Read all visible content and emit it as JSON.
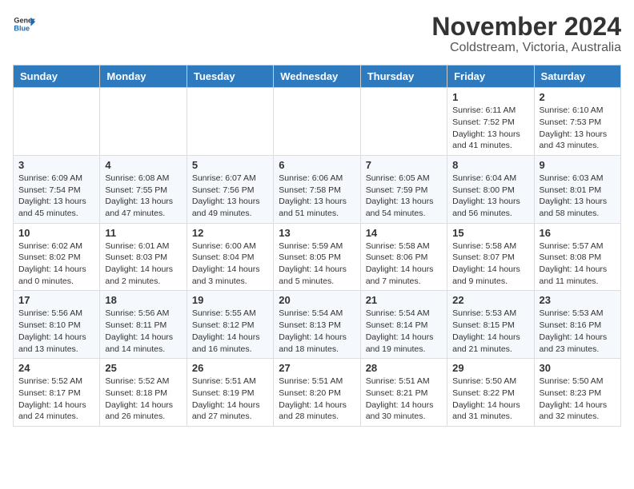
{
  "logo": {
    "general": "General",
    "blue": "Blue"
  },
  "title": "November 2024",
  "subtitle": "Coldstream, Victoria, Australia",
  "days": [
    "Sunday",
    "Monday",
    "Tuesday",
    "Wednesday",
    "Thursday",
    "Friday",
    "Saturday"
  ],
  "weeks": [
    [
      {
        "date": "",
        "info": ""
      },
      {
        "date": "",
        "info": ""
      },
      {
        "date": "",
        "info": ""
      },
      {
        "date": "",
        "info": ""
      },
      {
        "date": "",
        "info": ""
      },
      {
        "date": "1",
        "info": "Sunrise: 6:11 AM\nSunset: 7:52 PM\nDaylight: 13 hours\nand 41 minutes."
      },
      {
        "date": "2",
        "info": "Sunrise: 6:10 AM\nSunset: 7:53 PM\nDaylight: 13 hours\nand 43 minutes."
      }
    ],
    [
      {
        "date": "3",
        "info": "Sunrise: 6:09 AM\nSunset: 7:54 PM\nDaylight: 13 hours\nand 45 minutes."
      },
      {
        "date": "4",
        "info": "Sunrise: 6:08 AM\nSunset: 7:55 PM\nDaylight: 13 hours\nand 47 minutes."
      },
      {
        "date": "5",
        "info": "Sunrise: 6:07 AM\nSunset: 7:56 PM\nDaylight: 13 hours\nand 49 minutes."
      },
      {
        "date": "6",
        "info": "Sunrise: 6:06 AM\nSunset: 7:58 PM\nDaylight: 13 hours\nand 51 minutes."
      },
      {
        "date": "7",
        "info": "Sunrise: 6:05 AM\nSunset: 7:59 PM\nDaylight: 13 hours\nand 54 minutes."
      },
      {
        "date": "8",
        "info": "Sunrise: 6:04 AM\nSunset: 8:00 PM\nDaylight: 13 hours\nand 56 minutes."
      },
      {
        "date": "9",
        "info": "Sunrise: 6:03 AM\nSunset: 8:01 PM\nDaylight: 13 hours\nand 58 minutes."
      }
    ],
    [
      {
        "date": "10",
        "info": "Sunrise: 6:02 AM\nSunset: 8:02 PM\nDaylight: 14 hours\nand 0 minutes."
      },
      {
        "date": "11",
        "info": "Sunrise: 6:01 AM\nSunset: 8:03 PM\nDaylight: 14 hours\nand 2 minutes."
      },
      {
        "date": "12",
        "info": "Sunrise: 6:00 AM\nSunset: 8:04 PM\nDaylight: 14 hours\nand 3 minutes."
      },
      {
        "date": "13",
        "info": "Sunrise: 5:59 AM\nSunset: 8:05 PM\nDaylight: 14 hours\nand 5 minutes."
      },
      {
        "date": "14",
        "info": "Sunrise: 5:58 AM\nSunset: 8:06 PM\nDaylight: 14 hours\nand 7 minutes."
      },
      {
        "date": "15",
        "info": "Sunrise: 5:58 AM\nSunset: 8:07 PM\nDaylight: 14 hours\nand 9 minutes."
      },
      {
        "date": "16",
        "info": "Sunrise: 5:57 AM\nSunset: 8:08 PM\nDaylight: 14 hours\nand 11 minutes."
      }
    ],
    [
      {
        "date": "17",
        "info": "Sunrise: 5:56 AM\nSunset: 8:10 PM\nDaylight: 14 hours\nand 13 minutes."
      },
      {
        "date": "18",
        "info": "Sunrise: 5:56 AM\nSunset: 8:11 PM\nDaylight: 14 hours\nand 14 minutes."
      },
      {
        "date": "19",
        "info": "Sunrise: 5:55 AM\nSunset: 8:12 PM\nDaylight: 14 hours\nand 16 minutes."
      },
      {
        "date": "20",
        "info": "Sunrise: 5:54 AM\nSunset: 8:13 PM\nDaylight: 14 hours\nand 18 minutes."
      },
      {
        "date": "21",
        "info": "Sunrise: 5:54 AM\nSunset: 8:14 PM\nDaylight: 14 hours\nand 19 minutes."
      },
      {
        "date": "22",
        "info": "Sunrise: 5:53 AM\nSunset: 8:15 PM\nDaylight: 14 hours\nand 21 minutes."
      },
      {
        "date": "23",
        "info": "Sunrise: 5:53 AM\nSunset: 8:16 PM\nDaylight: 14 hours\nand 23 minutes."
      }
    ],
    [
      {
        "date": "24",
        "info": "Sunrise: 5:52 AM\nSunset: 8:17 PM\nDaylight: 14 hours\nand 24 minutes."
      },
      {
        "date": "25",
        "info": "Sunrise: 5:52 AM\nSunset: 8:18 PM\nDaylight: 14 hours\nand 26 minutes."
      },
      {
        "date": "26",
        "info": "Sunrise: 5:51 AM\nSunset: 8:19 PM\nDaylight: 14 hours\nand 27 minutes."
      },
      {
        "date": "27",
        "info": "Sunrise: 5:51 AM\nSunset: 8:20 PM\nDaylight: 14 hours\nand 28 minutes."
      },
      {
        "date": "28",
        "info": "Sunrise: 5:51 AM\nSunset: 8:21 PM\nDaylight: 14 hours\nand 30 minutes."
      },
      {
        "date": "29",
        "info": "Sunrise: 5:50 AM\nSunset: 8:22 PM\nDaylight: 14 hours\nand 31 minutes."
      },
      {
        "date": "30",
        "info": "Sunrise: 5:50 AM\nSunset: 8:23 PM\nDaylight: 14 hours\nand 32 minutes."
      }
    ]
  ]
}
